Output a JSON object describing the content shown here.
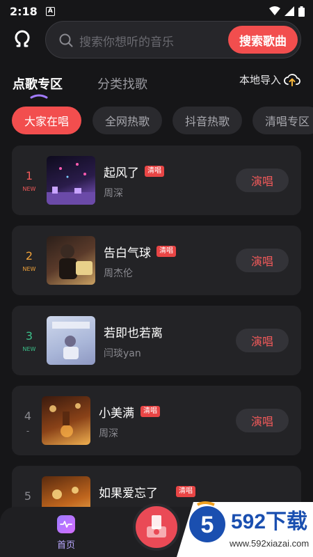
{
  "status_bar": {
    "time": "2:18",
    "indicator": "A"
  },
  "search": {
    "placeholder": "搜索你想听的音乐",
    "button_label": "搜索歌曲"
  },
  "tabs": [
    {
      "label": "点歌专区",
      "active": true
    },
    {
      "label": "分类找歌",
      "active": false
    }
  ],
  "import_label": "本地导入",
  "chips": [
    "大家在唱",
    "全网热歌",
    "抖音热歌",
    "清唱专区"
  ],
  "songs": [
    {
      "rank": "1",
      "new": "NEW",
      "title": "起风了",
      "tag": "清唱",
      "artist": "周深",
      "button": "演唱",
      "rank_color": "#f25a5a"
    },
    {
      "rank": "2",
      "new": "NEW",
      "title": "告白气球",
      "tag": "清唱",
      "artist": "周杰伦",
      "button": "演唱",
      "rank_color": "#f0a23a"
    },
    {
      "rank": "3",
      "new": "NEW",
      "title": "若即也若离",
      "tag": "",
      "artist": "闫琰yan",
      "button": "演唱",
      "rank_color": "#3cc08a"
    },
    {
      "rank": "4",
      "new": "-",
      "title": "小美满",
      "tag": "清唱",
      "artist": "周深",
      "button": "演唱",
      "rank_color": "#8a8a90"
    },
    {
      "rank": "5",
      "new": "",
      "title": "如果爱忘了",
      "tag": "清唱",
      "artist": "",
      "button": "",
      "rank_color": "#8a8a90"
    }
  ],
  "bottom_nav": {
    "home_label": "首页"
  },
  "watermark": {
    "number": "592下载",
    "url": "www.592xiazai.com"
  },
  "colors": {
    "accent": "#f24e4e",
    "background": "#161618",
    "card": "#232326"
  }
}
